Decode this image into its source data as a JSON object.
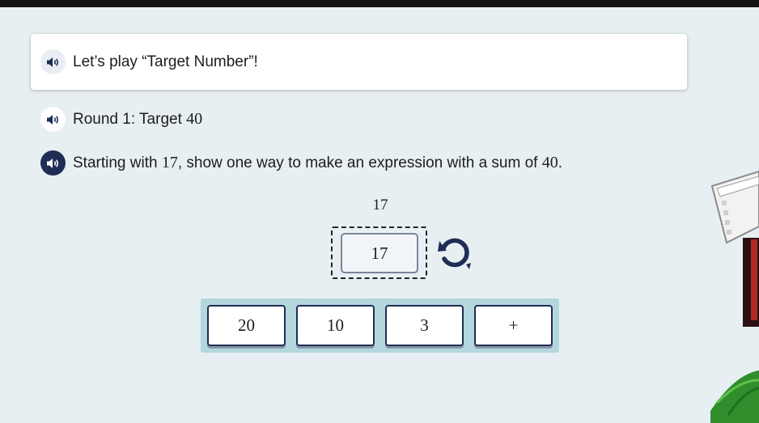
{
  "intro": {
    "text": "Let’s play “Target Number”!"
  },
  "round": {
    "prefix": "Round 1: Target ",
    "target": "40"
  },
  "prompt": {
    "part1": "Starting with ",
    "start": "17",
    "part2": ", show one way to make an expression with a sum of ",
    "target": "40",
    "part3": "."
  },
  "workspace": {
    "expression_value": "17",
    "placed_tile": "17"
  },
  "tiles": [
    "20",
    "10",
    "3",
    "+"
  ],
  "icons": {
    "speaker": "speaker-icon",
    "reset": "rotate-reset-icon"
  },
  "colors": {
    "background": "#e7eff3",
    "navy": "#1f2d54",
    "tray": "#b4d7de"
  }
}
